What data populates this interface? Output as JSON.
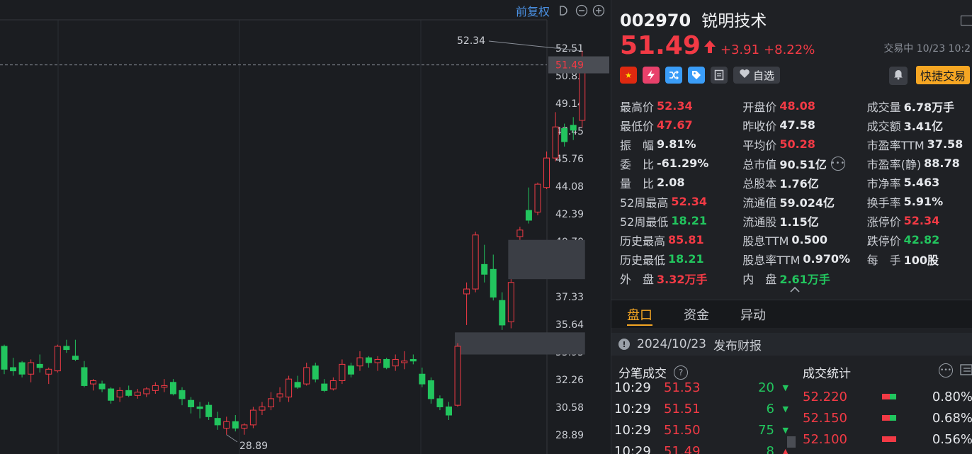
{
  "toolbar": {
    "adjust_label": "前复权"
  },
  "chart": {
    "high_annotation": "52.34",
    "low_annotation": "28.89",
    "current_price_tag": "51.49",
    "y_ticks": [
      "52.51",
      "50.83",
      "49.14",
      "47.45",
      "45.76",
      "44.08",
      "42.39",
      "40.70",
      "39.01",
      "37.33",
      "35.64",
      "33.95",
      "32.26",
      "30.58",
      "28.89"
    ]
  },
  "chart_data": {
    "type": "candlestick",
    "ylim": [
      28.89,
      52.51
    ],
    "grid": true,
    "up_color": "#f23a45",
    "down_color": "#22c55e",
    "candles": [
      {
        "o": 34.3,
        "h": 34.4,
        "l": 32.6,
        "c": 32.9
      },
      {
        "o": 33.0,
        "h": 33.6,
        "l": 32.5,
        "c": 32.8
      },
      {
        "o": 33.3,
        "h": 33.4,
        "l": 32.4,
        "c": 32.6
      },
      {
        "o": 32.6,
        "h": 33.5,
        "l": 32.1,
        "c": 33.3
      },
      {
        "o": 33.2,
        "h": 33.8,
        "l": 32.7,
        "c": 33.0
      },
      {
        "o": 32.6,
        "h": 33.0,
        "l": 32.0,
        "c": 32.9
      },
      {
        "o": 32.8,
        "h": 34.4,
        "l": 32.7,
        "c": 34.3
      },
      {
        "o": 34.3,
        "h": 34.7,
        "l": 33.9,
        "c": 34.1
      },
      {
        "o": 33.7,
        "h": 34.7,
        "l": 33.4,
        "c": 33.5
      },
      {
        "o": 33.0,
        "h": 33.4,
        "l": 31.8,
        "c": 31.9
      },
      {
        "o": 32.0,
        "h": 32.3,
        "l": 31.6,
        "c": 32.2
      },
      {
        "o": 32.0,
        "h": 32.2,
        "l": 31.5,
        "c": 31.7
      },
      {
        "o": 31.7,
        "h": 31.8,
        "l": 30.8,
        "c": 31.0
      },
      {
        "o": 31.2,
        "h": 31.8,
        "l": 30.9,
        "c": 31.6
      },
      {
        "o": 31.6,
        "h": 31.9,
        "l": 31.2,
        "c": 31.3
      },
      {
        "o": 31.3,
        "h": 31.7,
        "l": 31.1,
        "c": 31.5
      },
      {
        "o": 31.4,
        "h": 31.8,
        "l": 31.2,
        "c": 31.7
      },
      {
        "o": 31.6,
        "h": 32.1,
        "l": 31.4,
        "c": 31.9
      },
      {
        "o": 31.8,
        "h": 32.3,
        "l": 31.5,
        "c": 31.9
      },
      {
        "o": 32.1,
        "h": 32.3,
        "l": 31.3,
        "c": 31.4
      },
      {
        "o": 31.6,
        "h": 31.8,
        "l": 30.7,
        "c": 31.1
      },
      {
        "o": 31.0,
        "h": 31.2,
        "l": 30.2,
        "c": 30.6
      },
      {
        "o": 30.6,
        "h": 30.9,
        "l": 29.9,
        "c": 30.5
      },
      {
        "o": 30.7,
        "h": 30.9,
        "l": 29.8,
        "c": 30.0
      },
      {
        "o": 29.9,
        "h": 30.3,
        "l": 29.2,
        "c": 29.5
      },
      {
        "o": 29.3,
        "h": 30.0,
        "l": 28.9,
        "c": 29.7
      },
      {
        "o": 29.7,
        "h": 30.1,
        "l": 29.1,
        "c": 29.3
      },
      {
        "o": 29.3,
        "h": 29.6,
        "l": 28.9,
        "c": 29.5
      },
      {
        "o": 29.5,
        "h": 30.6,
        "l": 29.3,
        "c": 30.4
      },
      {
        "o": 30.4,
        "h": 30.9,
        "l": 30.1,
        "c": 30.6
      },
      {
        "o": 30.6,
        "h": 31.5,
        "l": 30.4,
        "c": 31.1
      },
      {
        "o": 31.2,
        "h": 31.8,
        "l": 30.9,
        "c": 31.4
      },
      {
        "o": 31.2,
        "h": 32.5,
        "l": 30.9,
        "c": 32.3
      },
      {
        "o": 32.1,
        "h": 32.5,
        "l": 31.7,
        "c": 31.8
      },
      {
        "o": 32.0,
        "h": 33.3,
        "l": 31.9,
        "c": 33.0
      },
      {
        "o": 33.1,
        "h": 33.3,
        "l": 32.1,
        "c": 32.3
      },
      {
        "o": 32.0,
        "h": 32.3,
        "l": 31.5,
        "c": 31.6
      },
      {
        "o": 31.7,
        "h": 32.4,
        "l": 31.6,
        "c": 32.2
      },
      {
        "o": 32.2,
        "h": 33.5,
        "l": 32.0,
        "c": 33.2
      },
      {
        "o": 33.1,
        "h": 33.3,
        "l": 32.4,
        "c": 32.6
      },
      {
        "o": 33.1,
        "h": 34.0,
        "l": 32.8,
        "c": 33.6
      },
      {
        "o": 33.6,
        "h": 33.7,
        "l": 33.0,
        "c": 33.3
      },
      {
        "o": 33.3,
        "h": 33.7,
        "l": 32.8,
        "c": 33.5
      },
      {
        "o": 33.5,
        "h": 33.6,
        "l": 32.9,
        "c": 33.0
      },
      {
        "o": 33.1,
        "h": 33.8,
        "l": 32.8,
        "c": 33.5
      },
      {
        "o": 33.3,
        "h": 34.0,
        "l": 32.9,
        "c": 33.4
      },
      {
        "o": 33.5,
        "h": 33.8,
        "l": 33.2,
        "c": 33.4
      },
      {
        "o": 32.6,
        "h": 33.0,
        "l": 31.8,
        "c": 32.0
      },
      {
        "o": 32.2,
        "h": 32.4,
        "l": 30.8,
        "c": 31.1
      },
      {
        "o": 31.1,
        "h": 31.3,
        "l": 30.4,
        "c": 30.6
      },
      {
        "o": 30.6,
        "h": 30.9,
        "l": 29.8,
        "c": 30.1
      },
      {
        "o": 30.7,
        "h": 34.5,
        "l": 30.6,
        "c": 34.3
      },
      {
        "o": 37.5,
        "h": 38.2,
        "l": 35.6,
        "c": 37.8
      },
      {
        "o": 37.8,
        "h": 41.3,
        "l": 37.6,
        "c": 41.1
      },
      {
        "o": 39.3,
        "h": 40.5,
        "l": 38.2,
        "c": 38.7
      },
      {
        "o": 39.0,
        "h": 39.9,
        "l": 37.1,
        "c": 37.3
      },
      {
        "o": 37.1,
        "h": 37.6,
        "l": 35.3,
        "c": 35.6
      },
      {
        "o": 35.8,
        "h": 38.4,
        "l": 35.4,
        "c": 38.2
      },
      {
        "o": 41.0,
        "h": 41.6,
        "l": 40.8,
        "c": 41.4
      },
      {
        "o": 42.6,
        "h": 44.0,
        "l": 41.8,
        "c": 42.0
      },
      {
        "o": 42.5,
        "h": 44.3,
        "l": 42.3,
        "c": 44.2
      },
      {
        "o": 44.0,
        "h": 46.2,
        "l": 43.9,
        "c": 45.8
      },
      {
        "o": 45.8,
        "h": 48.6,
        "l": 45.6,
        "c": 47.7
      },
      {
        "o": 47.6,
        "h": 47.9,
        "l": 46.5,
        "c": 46.8
      },
      {
        "o": 47.8,
        "h": 48.3,
        "l": 46.9,
        "c": 47.5
      },
      {
        "o": 48.1,
        "h": 52.34,
        "l": 47.67,
        "c": 51.49
      }
    ],
    "high_marker": 52.34,
    "low_marker": 28.89,
    "last_price": 51.49,
    "zones": [
      {
        "top": 40.8,
        "bottom": 38.4,
        "from_index": 57,
        "to_index": 65
      },
      {
        "top": 35.15,
        "bottom": 33.8,
        "from_index": 51,
        "to_index": 65
      }
    ]
  },
  "stock": {
    "code": "002970",
    "name": "锐明技术",
    "price": "51.49",
    "change": "+3.91",
    "change_pct": "+8.22%",
    "status": "交易中 10/23 10:2"
  },
  "tags": {
    "watchlist_label": "自选",
    "quick_trade_label": "快捷交易"
  },
  "stats": [
    [
      {
        "label": "最高价",
        "value": "52.34",
        "color": "red"
      },
      {
        "label": "开盘价",
        "value": "48.08",
        "color": "red"
      },
      {
        "label": "成交量",
        "value": "6.78万手",
        "color": "white"
      }
    ],
    [
      {
        "label": "最低价",
        "value": "47.67",
        "color": "red"
      },
      {
        "label": "昨收价",
        "value": "47.58",
        "color": "white"
      },
      {
        "label": "成交额",
        "value": "3.41亿",
        "color": "white"
      }
    ],
    [
      {
        "label": "振　幅",
        "value": "9.81%",
        "color": "white"
      },
      {
        "label": "平均价",
        "value": "50.28",
        "color": "red"
      },
      {
        "label": "市盈率TTM",
        "value": "37.58",
        "color": "white"
      }
    ],
    [
      {
        "label": "委　比",
        "value": "-61.29%",
        "color": "white"
      },
      {
        "label": "总市值",
        "value": "90.51亿",
        "color": "white"
      },
      {
        "label": "市盈率(静)",
        "value": "88.78",
        "color": "white"
      }
    ],
    [
      {
        "label": "量　比",
        "value": "2.08",
        "color": "white"
      },
      {
        "label": "总股本",
        "value": "1.76亿",
        "color": "white"
      },
      {
        "label": "市净率",
        "value": "5.463",
        "color": "white"
      }
    ],
    [
      {
        "label": "52周最高",
        "value": "52.34",
        "color": "red"
      },
      {
        "label": "流通值",
        "value": "59.024亿",
        "color": "white"
      },
      {
        "label": "换手率",
        "value": "5.91%",
        "color": "white"
      }
    ],
    [
      {
        "label": "52周最低",
        "value": "18.21",
        "color": "green"
      },
      {
        "label": "流通股",
        "value": "1.15亿",
        "color": "white"
      },
      {
        "label": "涨停价",
        "value": "52.34",
        "color": "red"
      }
    ],
    [
      {
        "label": "历史最高",
        "value": "85.81",
        "color": "red"
      },
      {
        "label": "股息TTM",
        "value": "0.500",
        "color": "white"
      },
      {
        "label": "跌停价",
        "value": "42.82",
        "color": "green"
      }
    ],
    [
      {
        "label": "历史最低",
        "value": "18.21",
        "color": "green"
      },
      {
        "label": "股息率TTM",
        "value": "0.970%",
        "color": "white"
      },
      {
        "label": "每　手",
        "value": "100股",
        "color": "white"
      }
    ],
    [
      {
        "label": "外　盘",
        "value": "3.32万手",
        "color": "red"
      },
      {
        "label": "内　盘",
        "value": "2.61万手",
        "color": "green"
      },
      null
    ]
  ],
  "tabs": [
    "盘口",
    "资金",
    "异动"
  ],
  "event": {
    "date": "2024/10/23",
    "text": "发布财报"
  },
  "ticks": {
    "title": "分笔成交",
    "rows": [
      {
        "time": "10:29",
        "price": "51.53",
        "vol": "20",
        "dir": "down"
      },
      {
        "time": "10:29",
        "price": "51.51",
        "vol": "6",
        "dir": "down"
      },
      {
        "time": "10:29",
        "price": "51.50",
        "vol": "75",
        "dir": "down"
      },
      {
        "time": "10:29",
        "price": "51.49",
        "vol": "8",
        "dir": "up"
      }
    ]
  },
  "trade_stats": {
    "title": "成交统计",
    "rows": [
      {
        "price": "52.220",
        "pct": "0.80%",
        "buy_ratio": 0.55
      },
      {
        "price": "52.150",
        "pct": "0.68%",
        "buy_ratio": 0.55
      },
      {
        "price": "52.100",
        "pct": "0.56%",
        "buy_ratio": 1.0
      }
    ]
  },
  "colors": {
    "red": "#f23a45",
    "green": "#22c55e",
    "accent": "#f5a623",
    "link": "#4a90e2"
  }
}
